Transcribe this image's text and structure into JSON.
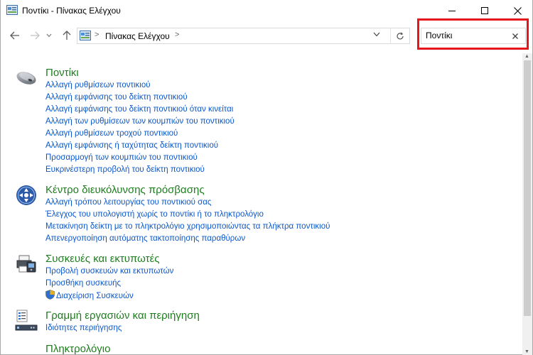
{
  "window": {
    "title": "Ποντίκι - Πίνακας Ελέγχου"
  },
  "address": {
    "crumb": "Πίνακας Ελέγχου",
    "separator": ">",
    "separator_after": ">"
  },
  "search": {
    "value": "Ποντίκι",
    "clear_label": "×"
  },
  "groups": [
    {
      "title": "Ποντίκι",
      "icon": "mouse-icon",
      "links": [
        "Αλλαγή ρυθμίσεων ποντικιού",
        "Αλλαγή εμφάνισης του δείκτη ποντικιού",
        "Αλλαγή εμφάνισης του δείκτη ποντικιού όταν κινείται",
        "Αλλαγή των ρυθμίσεων των κουμπιών του ποντικιού",
        "Αλλαγή ρυθμίσεων τροχού ποντικιού",
        "Αλλαγή εμφάνισης ή ταχύτητας δείκτη ποντικιού",
        "Προσαρμογή των κουμπιών του ποντικιού",
        "Ευκρινέστερη προβολή του δείκτη ποντικιού"
      ]
    },
    {
      "title": "Κέντρο διευκόλυνσης πρόσβασης",
      "icon": "ease-of-access-icon",
      "links": [
        "Αλλαγή τρόπου λειτουργίας του ποντικιού σας",
        "Έλεγχος του υπολογιστή χωρίς το ποντίκι ή το πληκτρολόγιο",
        "Μετακίνηση δείκτη με το πληκτρολόγιο χρησιμοποιώντας τα πλήκτρα ποντικιού",
        "Απενεργοποίηση αυτόματης τακτοποίησης παραθύρων"
      ]
    },
    {
      "title": "Συσκευές και εκτυπωτές",
      "icon": "printer-icon",
      "links": [
        "Προβολή συσκευών και εκτυπωτών",
        "Προσθήκη συσκευής",
        "Διαχείριση Συσκευών"
      ]
    },
    {
      "title": "Γραμμή εργασιών και περιήγηση",
      "icon": "taskbar-icon",
      "links": [
        "Ιδιότητες περιήγησης"
      ]
    },
    {
      "title": "Πληκτρολόγιο",
      "icon": "keyboard-icon",
      "links": []
    }
  ]
}
